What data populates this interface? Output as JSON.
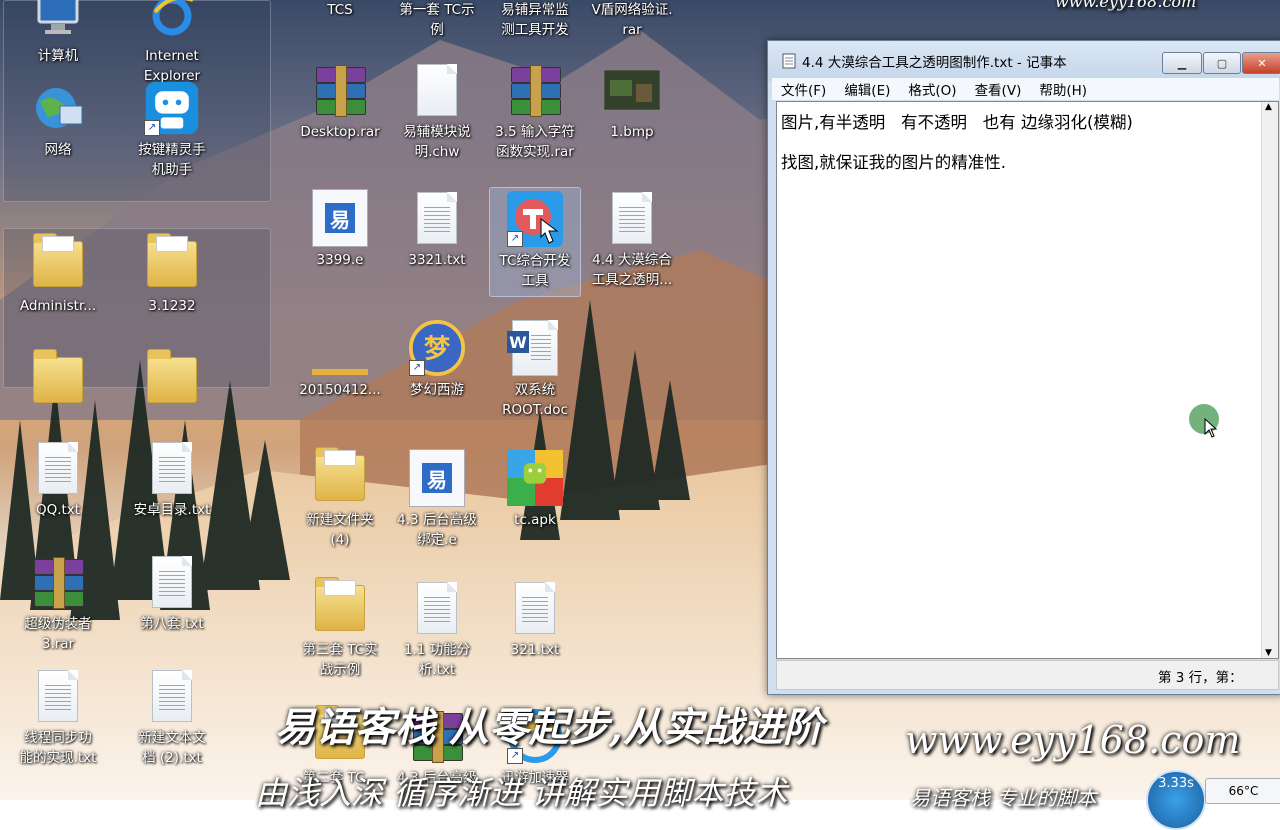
{
  "wallpaper": {
    "colors": {
      "sky": "#3a4a66",
      "sunset": "#d7a778",
      "snow": "#f1e8de",
      "trees": "#1f2a24"
    }
  },
  "watermark_top": "www.eyy168.com",
  "left_panel_icons": [
    {
      "label": "计算机",
      "icon": "computer-icon"
    },
    {
      "label": "Internet\nExplorer",
      "icon": "internet-explorer-icon"
    },
    {
      "label": "网络",
      "icon": "network-globe-icon"
    },
    {
      "label": "按键精灵手\n机助手",
      "icon": "anjian-robot-icon"
    },
    {
      "label": "Administr...",
      "icon": "user-folder-icon"
    },
    {
      "label": "3.1232",
      "icon": "folder-icon"
    },
    {
      "label": "QQ.txt",
      "icon": "text-file-icon"
    },
    {
      "label": "安卓目录.txt",
      "icon": "text-file-icon"
    },
    {
      "label": "超级伪装者\n3.rar",
      "icon": "rar-archive-icon"
    },
    {
      "label": "第八套.txt",
      "icon": "text-file-icon"
    },
    {
      "label": "线程同步功\n能的实现.txt",
      "icon": "text-file-icon"
    },
    {
      "label": "新建文本文\n档 (2).txt",
      "icon": "text-file-icon"
    }
  ],
  "middle_icons": [
    {
      "label": "TCS",
      "icon": "app-icon"
    },
    {
      "label": "第一套 TC示\n例",
      "icon": "folder-icon"
    },
    {
      "label": "易铺异常监\n测工具开发",
      "icon": "folder-icon"
    },
    {
      "label": "V盾网络验证.\nrar",
      "icon": "rar-archive-icon"
    },
    {
      "label": "Desktop.rar",
      "icon": "rar-archive-icon"
    },
    {
      "label": "易辅模块说\n明.chw",
      "icon": "chw-file-icon"
    },
    {
      "label": "3.5 输入字符\n函数实现.rar",
      "icon": "rar-archive-icon"
    },
    {
      "label": "1.bmp",
      "icon": "bitmap-image-icon"
    },
    {
      "label": "3399.e",
      "icon": "e-language-file-icon"
    },
    {
      "label": "3321.txt",
      "icon": "text-file-icon"
    },
    {
      "label": "TC综合开发\n工具",
      "icon": "tc-dev-tool-icon"
    },
    {
      "label": "4.4 大漠综合\n工具之透明...",
      "icon": "text-file-icon"
    },
    {
      "label": "20150412...",
      "icon": "folder-icon"
    },
    {
      "label": "梦幻西游",
      "icon": "menghuan-xiyou-icon"
    },
    {
      "label": "双系统\nROOT.doc",
      "icon": "word-doc-icon"
    },
    {
      "label": "新建文件夹\n(4)",
      "icon": "folder-icon"
    },
    {
      "label": "4.3 后台高级\n绑定.e",
      "icon": "e-language-file-icon"
    },
    {
      "label": "tc.apk",
      "icon": "android-apk-icon"
    },
    {
      "label": "第三套 TC实\n战示例",
      "icon": "folder-icon"
    },
    {
      "label": "1.1 功能分\n析.txt",
      "icon": "text-file-icon"
    },
    {
      "label": "321.txt",
      "icon": "text-file-icon"
    },
    {
      "label": "第二套 TC...",
      "icon": "folder-icon"
    },
    {
      "label": "4.3 后台高级",
      "icon": "rar-archive-icon"
    },
    {
      "label": "迅游加速器",
      "icon": "xunyou-accelerator-icon"
    }
  ],
  "notepad": {
    "title": "4.4 大漠综合工具之透明图制作.txt - 记事本",
    "menu": [
      "文件(F)",
      "编辑(E)",
      "格式(O)",
      "查看(V)",
      "帮助(H)"
    ],
    "lines": [
      "图片,有半透明   有不透明   也有 边缘羽化(模糊)",
      "找图,就保证我的图片的精准性."
    ],
    "status": "第 3 行，第："
  },
  "overlay": {
    "slogan": "易语客栈 从零起步,从实战进阶",
    "url": "www.eyy168.com",
    "bottom_left": "由浅入深 循序渐进 讲解实用脚本技术",
    "bottom_right": "易语客栈 专业的脚本"
  },
  "tray": {
    "speed": "3.33s",
    "temp": "66°C"
  }
}
